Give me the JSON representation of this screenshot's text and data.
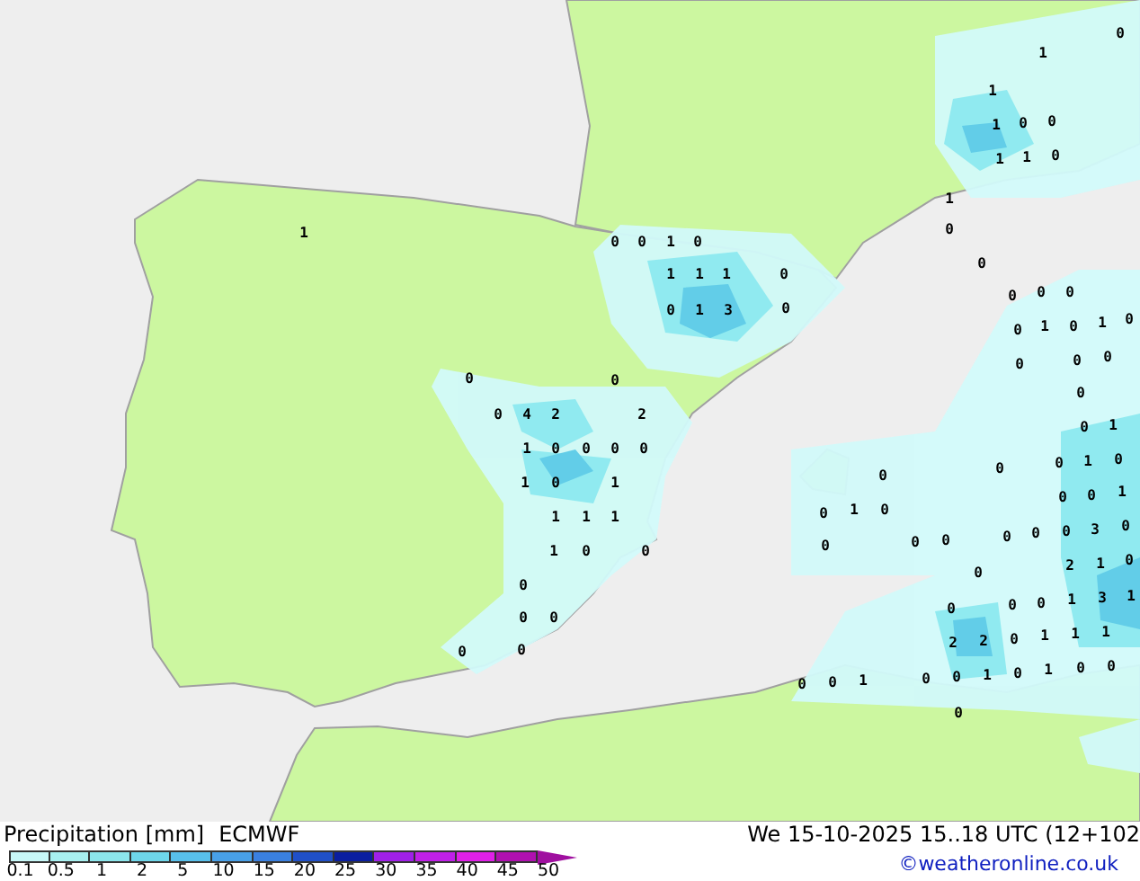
{
  "map": {
    "values": [
      "0",
      "1",
      "1",
      "1",
      "0",
      "0",
      "1",
      "1",
      "0",
      "1",
      "1",
      "0",
      "0",
      "0",
      "1",
      "0",
      "0",
      "1",
      "1",
      "1",
      "0",
      "0",
      "0",
      "0",
      "0",
      "1",
      "3",
      "0",
      "0",
      "1",
      "0",
      "1",
      "0",
      "0",
      "0",
      "0",
      "0",
      "0",
      "0",
      "0",
      "4",
      "2",
      "2",
      "0",
      "1",
      "1",
      "0",
      "0",
      "0",
      "0",
      "0",
      "0",
      "0",
      "1",
      "0",
      "1",
      "0",
      "1",
      "0",
      "0",
      "1",
      "1",
      "1",
      "1",
      "0",
      "1",
      "0",
      "1",
      "0",
      "0",
      "0",
      "0",
      "0",
      "0",
      "0",
      "0",
      "3",
      "0",
      "0",
      "2",
      "1",
      "0",
      "0",
      "0",
      "0",
      "0",
      "1",
      "3",
      "1",
      "0",
      "0",
      "2",
      "2",
      "0",
      "1",
      "1",
      "1",
      "0",
      "0",
      "0",
      "0",
      "1",
      "0",
      "0",
      "1",
      "0",
      "1",
      "0",
      "0",
      "0"
    ]
  },
  "footer": {
    "title": "Precipitation [mm]",
    "model": "ECMWF",
    "valid_time": "We 15-10-2025 15..18 UTC (12+102",
    "credit": "©weatheronline.co.uk",
    "scale": [
      {
        "color": "#c8f8f8"
      },
      {
        "color": "#a8f0f0"
      },
      {
        "color": "#8ce6ec"
      },
      {
        "color": "#6ed6ea"
      },
      {
        "color": "#58c0ec"
      },
      {
        "color": "#48a0e8"
      },
      {
        "color": "#3a80e0"
      },
      {
        "color": "#2050c8"
      },
      {
        "color": "#0a1ea0"
      },
      {
        "color": "#a020e8"
      },
      {
        "color": "#c020e8"
      },
      {
        "color": "#e020e8"
      },
      {
        "color": "#b010b0"
      }
    ],
    "ticks": [
      "0.1",
      "0.5",
      "1",
      "2",
      "5",
      "10",
      "15",
      "20",
      "25",
      "30",
      "35",
      "40",
      "45",
      "50"
    ]
  }
}
